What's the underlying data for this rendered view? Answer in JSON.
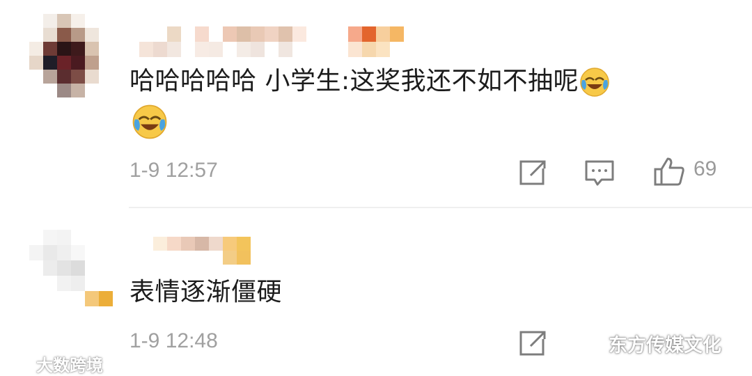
{
  "comments": [
    {
      "text": "哈哈哈哈哈 小学生:这奖我还不如不抽呢",
      "emoji": "laugh-cry-emoji",
      "time": "1-9 12:57",
      "likes": "69"
    },
    {
      "text": "表情逐渐僵硬",
      "time": "1-9 12:48"
    }
  ],
  "watermarks": {
    "left": "大数跨境",
    "right": "东方传媒文化"
  },
  "colors": {
    "text": "#1c1c1c",
    "meta": "#a0a0a0",
    "emoji_face": "#f7c948",
    "emoji_tear": "#4aa3e0"
  }
}
